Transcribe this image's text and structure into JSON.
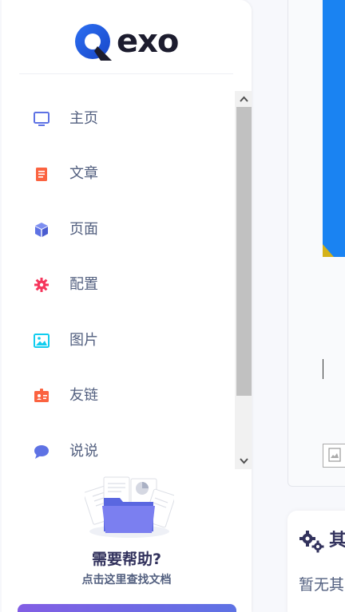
{
  "brand": {
    "name": "exo"
  },
  "nav": {
    "items": [
      {
        "label": "主页",
        "icon": "monitor-icon",
        "color": "#5e72e4"
      },
      {
        "label": "文章",
        "icon": "article-icon",
        "color": "#fb6340"
      },
      {
        "label": "页面",
        "icon": "cube-icon",
        "color": "#5e72e4"
      },
      {
        "label": "配置",
        "icon": "gear-icon",
        "color": "#f5365c"
      },
      {
        "label": "图片",
        "icon": "image-icon",
        "color": "#11cdef"
      },
      {
        "label": "友链",
        "icon": "id-card-icon",
        "color": "#fb6340"
      },
      {
        "label": "说说",
        "icon": "chat-bubble-icon",
        "color": "#5e72e4"
      }
    ]
  },
  "help": {
    "title": "需要帮助?",
    "subtitle": "点击这里查找文档"
  },
  "main": {
    "card2_title": "其",
    "card2_text": "暂无其"
  },
  "colors": {
    "accent": "#5e72e4",
    "accent_purple": "#825ee4",
    "blue_panel": "#1a83f2"
  }
}
